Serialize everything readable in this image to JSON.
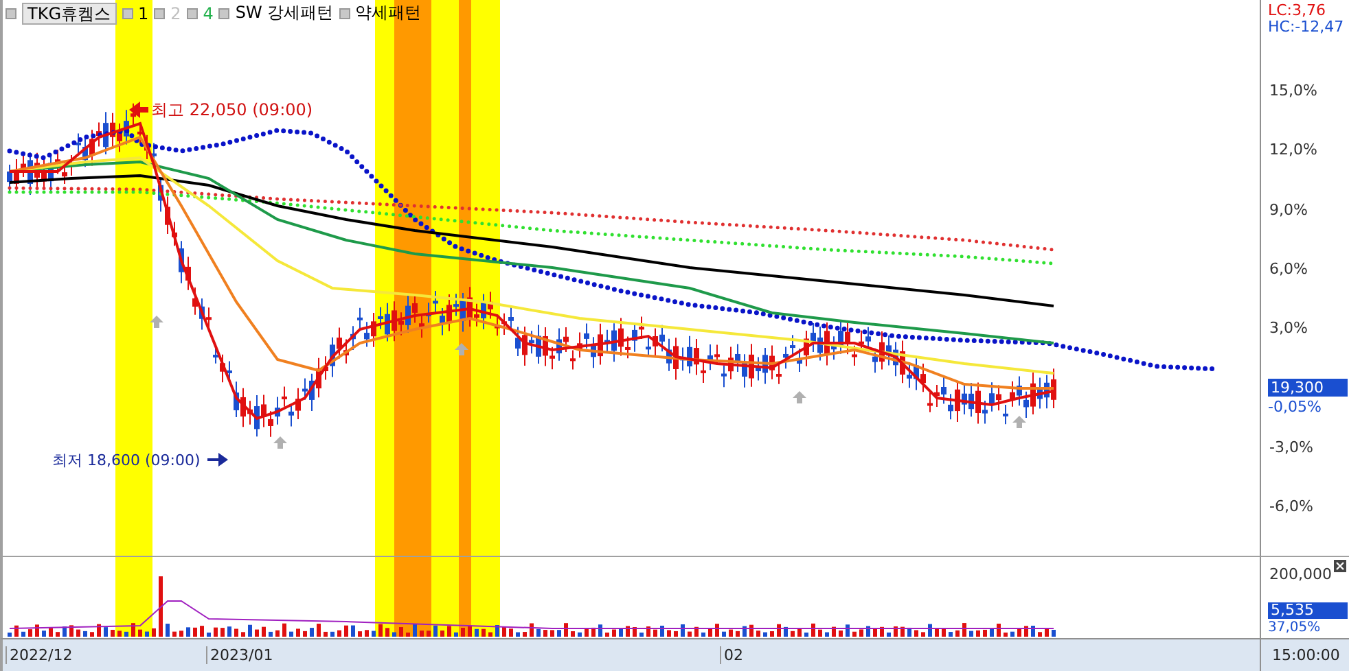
{
  "legend": {
    "stock_button": "TKG휴켐스",
    "items": [
      {
        "label": "1",
        "color": "#000000"
      },
      {
        "label": "2",
        "color": "#c0c0c0"
      },
      {
        "label": "4",
        "color": "#22b14c"
      },
      {
        "label": "SW 강세패턴",
        "color": "#000000"
      },
      {
        "label": "약세패턴",
        "color": "#000000"
      }
    ]
  },
  "price_axis": {
    "lc": "LC:3,76",
    "hc": "HC:-12,47",
    "ticks": [
      "15,0%",
      "12,0%",
      "9,0%",
      "6,0%",
      "3,0%",
      "-3,0%",
      "-6,0%"
    ],
    "price_label": "19,300",
    "price_change": "-0,05%"
  },
  "annotations": {
    "high": "최고 22,050 (09:00)",
    "low": "최저 18,600 (09:00)"
  },
  "volume_axis": {
    "tick": "200,000",
    "volume_label": "5,535",
    "volume_ratio": "37,05%"
  },
  "date_axis": {
    "labels": [
      "2022/12",
      "2023/01",
      "02"
    ],
    "time": "15:00:00"
  }
}
